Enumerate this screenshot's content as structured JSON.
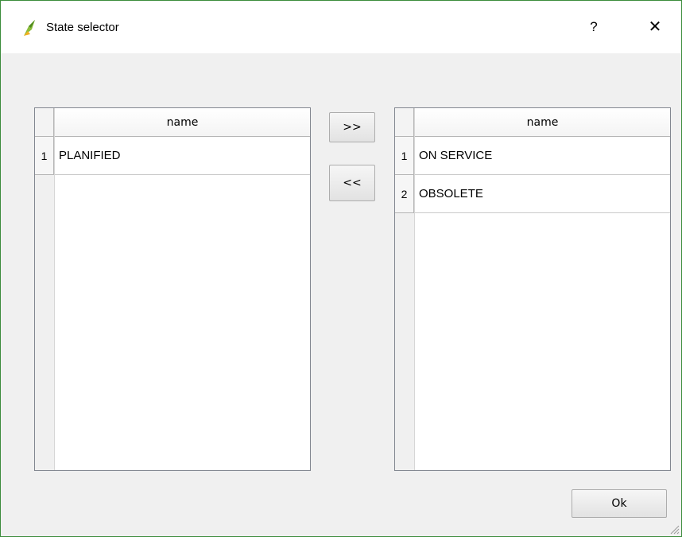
{
  "window": {
    "title": "State selector",
    "help_label": "?",
    "close_label": "✕",
    "border_color": "#3c8c3c"
  },
  "left_table": {
    "header": "name",
    "rows": [
      {
        "num": "1",
        "name": "PLANIFIED"
      }
    ]
  },
  "right_table": {
    "header": "name",
    "rows": [
      {
        "num": "1",
        "name": "ON SERVICE"
      },
      {
        "num": "2",
        "name": "OBSOLETE"
      }
    ]
  },
  "buttons": {
    "add_label": ">>",
    "remove_label": "<<",
    "ok_label": "Ok"
  },
  "icons": {
    "app": "qgis-logo-icon",
    "resize": "resize-grip-icon"
  }
}
